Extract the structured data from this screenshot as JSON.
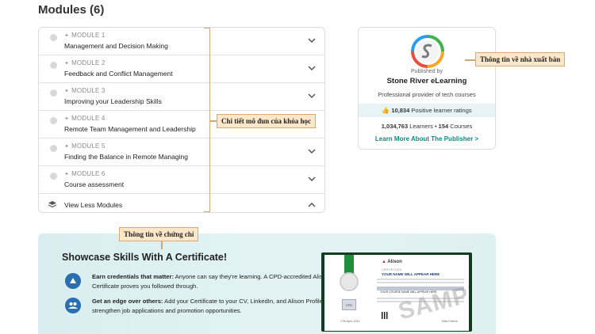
{
  "page_title": "Modules (6)",
  "modules": [
    {
      "tag": "MODULE 1",
      "title": "Management and Decision Making"
    },
    {
      "tag": "MODULE 2",
      "title": "Feedback and Conflict Management"
    },
    {
      "tag": "MODULE 3",
      "title": "Improving your Leadership Skills"
    },
    {
      "tag": "MODULE 4",
      "title": "Remote Team Management and Leadership"
    },
    {
      "tag": "MODULE 5",
      "title": "Finding the Balance in Remote Managing"
    },
    {
      "tag": "MODULE 6",
      "title": "Course assessment"
    }
  ],
  "view_less_label": "View Less Modules",
  "publisher": {
    "published_by": "Published by",
    "name": "Stone River eLearning",
    "description": "Professional provider of tech courses",
    "ratings_count": "10,834",
    "ratings_label": "Positive learner ratings",
    "learners_count": "1,034,763",
    "learners_label": "Learners",
    "separator": "•",
    "courses_count": "154",
    "courses_label": "Courses",
    "link_label": "Learn More About The Publisher >"
  },
  "callouts": {
    "modules": "Chi tiết mô đun của khóa học",
    "publisher": "Thông tin về nhà xuất bản",
    "certificate": "Thông tin về chứng chỉ"
  },
  "certificate": {
    "title": "Showcase Skills With A Certificate!",
    "features": [
      {
        "bold": "Earn credentials that matter:",
        "text": " Anyone can say they're learning. A CPD-accredited Alison Certificate proves you followed through."
      },
      {
        "bold": "Get an edge over others:",
        "text": " Add your Certificate to your CV, LinkedIn, and Alison Profile to strengthen job applications and promotion opportunities."
      }
    ],
    "preview": {
      "brand": "Alison",
      "label": "CERTIFICATE",
      "name": "YOUR NAME WILL APPEAR HERE",
      "course": "YOUR COURSE NAME WILL APPEAR HERE",
      "watermark": "SAMPLE",
      "badge": "CPD",
      "date": "17th April, 2024",
      "signer": "Mike Feerick"
    }
  },
  "colors": {
    "accent_link": "#0a8a7e",
    "callout_bg": "#fde7c9",
    "callout_border": "#e0a869",
    "cert_frame": "#0f3d1f",
    "ribbon": "#1f8e3a"
  }
}
